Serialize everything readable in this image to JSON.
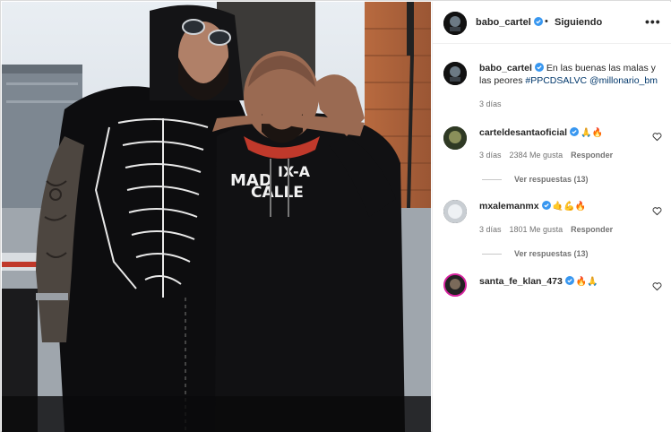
{
  "post": {
    "author": "babo_cartel",
    "follow_status": "Siguiendo",
    "separator": "•",
    "more_label": "•••"
  },
  "caption": {
    "username": "babo_cartel",
    "text": "En las buenas las malas y las peores",
    "hashtag": "#PPCDSALVC",
    "mention": "@millonario_bm",
    "time": "3 días"
  },
  "comments": [
    {
      "username": "carteldesantaoficial",
      "emojis": "🙏🔥",
      "time": "3 días",
      "likes": "2384 Me gusta",
      "reply": "Responder",
      "view_replies": "Ver respuestas (13)"
    },
    {
      "username": "mxalemanmx",
      "emojis": "🤙💪🔥",
      "time": "3 días",
      "likes": "1801 Me gusta",
      "reply": "Responder",
      "view_replies": "Ver respuestas (13)"
    },
    {
      "username": "santa_fe_klan_473",
      "emojis": "🔥🙏",
      "time": "",
      "likes": "",
      "reply": "",
      "view_replies": ""
    }
  ],
  "colors": {
    "verified": "#3897f0",
    "link": "#00376b",
    "muted": "#737373",
    "border": "#dbdbdb"
  },
  "photo": {
    "hoodie_left_text": "MAD",
    "hoodie_right_text": "IX-A",
    "hoodie_bottom_text": "CALLE"
  }
}
